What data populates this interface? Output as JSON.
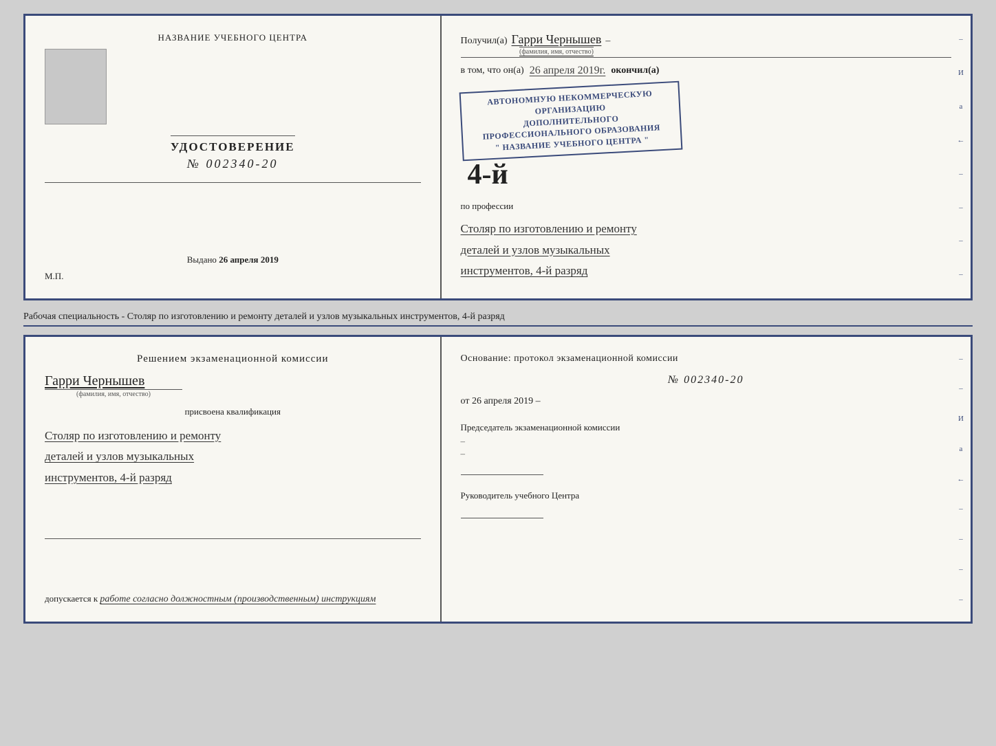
{
  "top_left": {
    "center_title": "НАЗВАНИЕ УЧЕБНОГО ЦЕНТРА",
    "cert_title": "УДОСТОВЕРЕНИЕ",
    "cert_number": "№ 002340-20",
    "issued_label": "Выдано",
    "issued_date": "26 апреля 2019",
    "mp_label": "М.П."
  },
  "top_right": {
    "received_label": "Получил(а)",
    "recipient_name": "Гарри Чернышев",
    "name_sublabel": "(фамилия, имя, отчество)",
    "in_that": "в том, что он(а)",
    "date_value": "26 апреля 2019г.",
    "finished_label": "окончил(а)",
    "stamp_line1": "АВТОНОМНУЮ НЕКОММЕРЧЕСКУЮ ОРГАНИЗАЦИЮ",
    "stamp_line2": "ДОПОЛНИТЕЛЬНОГО ПРОФЕССИОНАЛЬНОГО ОБРАЗОВАНИЯ",
    "stamp_line3": "\" НАЗВАНИЕ УЧЕБНОГО ЦЕНТРА \"",
    "rank_badge": "4-й",
    "profession_prefix": "по профессии",
    "profession_line1": "Столяр по изготовлению и ремонту",
    "profession_line2": "деталей и узлов музыкальных",
    "profession_line3": "инструментов, 4-й разряд",
    "side_letters": [
      "И",
      "а",
      "←",
      "–",
      "–",
      "–",
      "–",
      "–"
    ]
  },
  "separator": {
    "text": "Рабочая специальность - Столяр по изготовлению и ремонту деталей и узлов музыкальных инструментов, 4-й разряд"
  },
  "bottom_left": {
    "decision_title": "Решением экзаменационной комиссии",
    "recipient_name": "Гарри Чернышев",
    "name_sublabel": "(фамилия, имя, отчество)",
    "qualification_label": "присвоена квалификация",
    "profession_line1": "Столяр по изготовлению и ремонту",
    "profession_line2": "деталей и узлов музыкальных",
    "profession_line3": "инструментов, 4-й разряд",
    "allow_prefix": "допускается к",
    "allow_text": "работе согласно должностным (производственным) инструкциям"
  },
  "bottom_right": {
    "basis_label": "Основание: протокол экзаменационной комиссии",
    "protocol_number": "№ 002340-20",
    "date_prefix": "от",
    "date_value": "26 апреля 2019",
    "chairman_label": "Председатель экзаменационной комиссии",
    "director_label": "Руководитель учебного Центра",
    "side_letters": [
      "И",
      "а",
      "←",
      "–",
      "–",
      "–",
      "–",
      "–"
    ]
  }
}
